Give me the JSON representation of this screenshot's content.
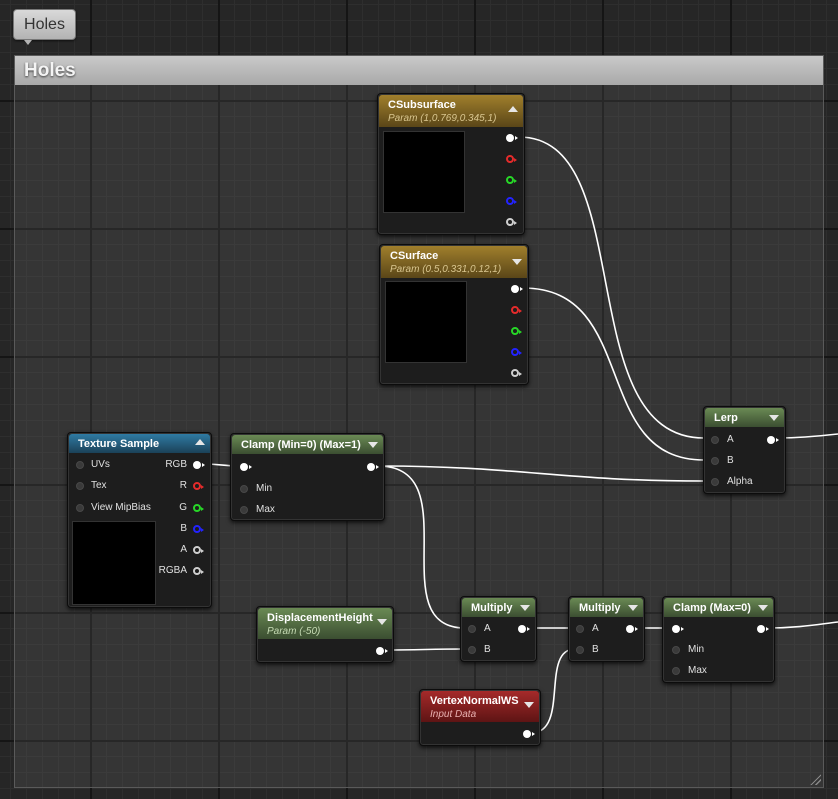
{
  "tab": {
    "label": "Holes"
  },
  "comment": {
    "title": "Holes"
  },
  "nodes": {
    "csubsurface": {
      "title": "CSubsurface",
      "subtitle": "Param (1,0.769,0.345,1)"
    },
    "csurface": {
      "title": "CSurface",
      "subtitle": "Param (0.5,0.331,0.12,1)"
    },
    "texture_sample": {
      "title": "Texture Sample",
      "inputs": [
        "UVs",
        "Tex",
        "View MipBias"
      ],
      "outputs": [
        "RGB",
        "R",
        "G",
        "B",
        "A",
        "RGBA"
      ]
    },
    "clamp1": {
      "title": "Clamp (Min=0) (Max=1)",
      "inputs": [
        "Min",
        "Max"
      ]
    },
    "lerp": {
      "title": "Lerp",
      "inputs": [
        "A",
        "B",
        "Alpha"
      ]
    },
    "displacement": {
      "title": "DisplacementHeight",
      "subtitle": "Param (-50)"
    },
    "multiply1": {
      "title": "Multiply",
      "inputs": [
        "A",
        "B"
      ]
    },
    "multiply2": {
      "title": "Multiply",
      "inputs": [
        "A",
        "B"
      ]
    },
    "clamp2": {
      "title": "Clamp (Max=0)",
      "inputs": [
        "Min",
        "Max"
      ]
    },
    "vertex_normal": {
      "title": "VertexNormalWS",
      "subtitle": "Input Data"
    }
  },
  "colors": {
    "param_header": "#a07f2c",
    "texture_header": "#2f7aa3",
    "math_header": "#6a8a54",
    "input_header": "#a52a2a",
    "wire": "#ffffff"
  }
}
